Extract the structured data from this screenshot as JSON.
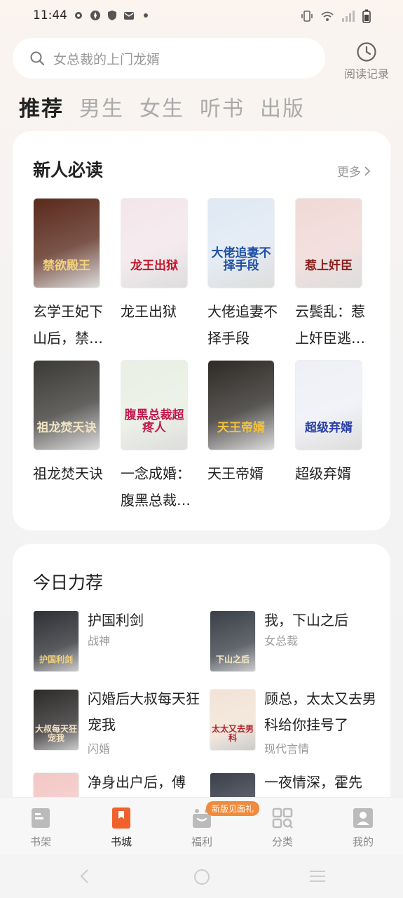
{
  "status_bar": {
    "time": "11:44"
  },
  "search": {
    "placeholder": "女总裁的上门龙婿",
    "history_label": "阅读记录"
  },
  "tabs": [
    {
      "label": "推荐",
      "active": true
    },
    {
      "label": "男生",
      "active": false
    },
    {
      "label": "女生",
      "active": false
    },
    {
      "label": "听书",
      "active": false
    },
    {
      "label": "出版",
      "active": false
    }
  ],
  "new_reader": {
    "title": "新人必读",
    "more_label": "更多",
    "books": [
      {
        "title": "玄学王妃下山后，禁…",
        "cover_text": "禁欲殿王",
        "cover_bg": "#5a2a1c",
        "cover_fg": "#f5d27a"
      },
      {
        "title": "龙王出狱",
        "cover_text": "龙王出狱",
        "cover_bg": "#f3e6ea",
        "cover_fg": "#c0142b"
      },
      {
        "title": "大佬追妻不择手段",
        "cover_text": "大佬追妻不择手段",
        "cover_bg": "#dfe8f3",
        "cover_fg": "#1d4fa3"
      },
      {
        "title": "云鬓乱：惹上奸臣逃…",
        "cover_text": "惹上奸臣",
        "cover_bg": "#f0d9d6",
        "cover_fg": "#8c1f1f"
      },
      {
        "title": "祖龙焚天诀",
        "cover_text": "祖龙焚天诀",
        "cover_bg": "#3c3a37",
        "cover_fg": "#f1e4c2"
      },
      {
        "title": "一念成婚：腹黑总裁…",
        "cover_text": "腹黑总裁超疼人",
        "cover_bg": "#e9efe3",
        "cover_fg": "#c1184e"
      },
      {
        "title": "天王帝婿",
        "cover_text": "天王帝婿",
        "cover_bg": "#2e2b27",
        "cover_fg": "#f4c23c"
      },
      {
        "title": "超级弃婿",
        "cover_text": "超级弃婿",
        "cover_bg": "#eef0f6",
        "cover_fg": "#2a3fa6"
      }
    ]
  },
  "today": {
    "title": "今日力荐",
    "items": [
      {
        "title": "护国利剑",
        "tag": "战神",
        "cover_text": "护国利剑",
        "cover_bg": "#2f3035",
        "cover_fg": "#f3d27a"
      },
      {
        "title": "我，下山之后",
        "tag": "女总裁",
        "cover_text": "下山之后",
        "cover_bg": "#3b4048",
        "cover_fg": "#f6e9c6"
      },
      {
        "title": "闪婚后大叔每天狂宠我",
        "tag": "闪婚",
        "cover_text": "大叔每天狂宠我",
        "cover_bg": "#2d2a2a",
        "cover_fg": "#f6e3c5"
      },
      {
        "title": "顾总，太太又去男科给你挂号了",
        "tag": "现代言情",
        "cover_text": "太太又去男科",
        "cover_bg": "#f2e3d6",
        "cover_fg": "#b0262c"
      },
      {
        "title": "净身出户后，傅",
        "tag": "",
        "cover_text": "",
        "cover_bg": "#f2c7c5",
        "cover_fg": "#222"
      },
      {
        "title": "一夜情深，霍先",
        "tag": "",
        "cover_text": "",
        "cover_bg": "#3a3f4a",
        "cover_fg": "#fff"
      }
    ]
  },
  "bottom_nav": {
    "items": [
      {
        "label": "书架",
        "icon": "bookshelf-icon"
      },
      {
        "label": "书城",
        "icon": "bookstore-icon",
        "active": true
      },
      {
        "label": "福利",
        "icon": "gift-icon"
      },
      {
        "label": "分类",
        "icon": "category-icon"
      },
      {
        "label": "我的",
        "icon": "profile-icon"
      }
    ],
    "badge": "新版见面礼"
  },
  "colors": {
    "accent": "#f0612c",
    "badge": "#f08a3c"
  }
}
